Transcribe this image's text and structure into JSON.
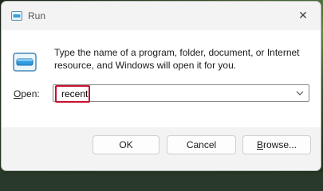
{
  "window": {
    "title": "Run",
    "close_glyph": "✕"
  },
  "dialog": {
    "description": "Type the name of a program, folder, document, or Internet resource, and Windows will open it for you.",
    "open_label_mnemonic": "O",
    "open_label_rest": "pen:",
    "open_value": "recent",
    "icon": "run-app-icon"
  },
  "buttons": {
    "ok": "OK",
    "cancel": "Cancel",
    "browse_mnemonic": "B",
    "browse_rest": "rowse..."
  },
  "colors": {
    "highlight_border": "#c8102e",
    "window_bg": "#f3f3f3"
  }
}
